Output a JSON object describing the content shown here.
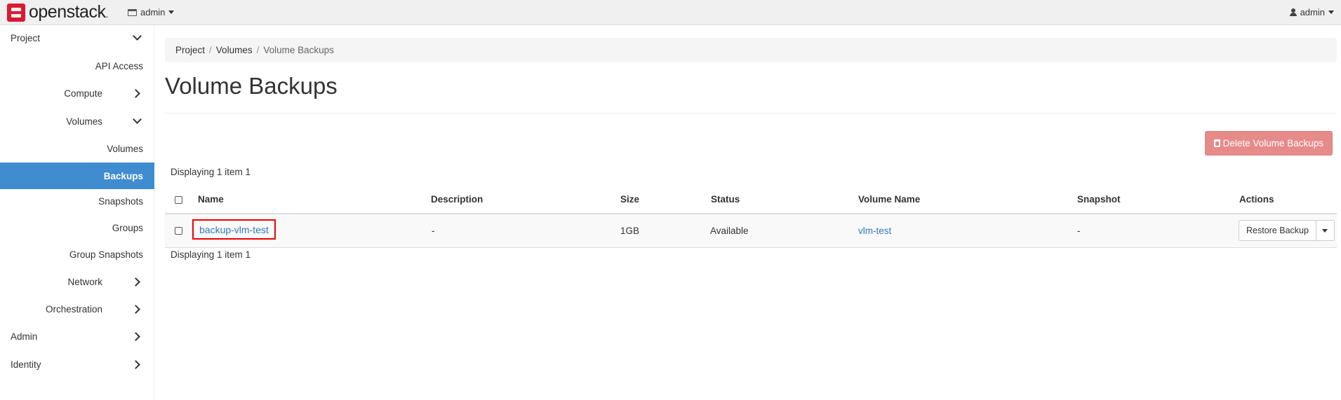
{
  "topbar": {
    "brand": "openstack",
    "brand_dot": ".",
    "project": "admin",
    "user": "admin"
  },
  "sidebar": {
    "items": [
      {
        "label": "Project",
        "level": 1,
        "chevron": "down"
      },
      {
        "label": "API Access",
        "level": 2
      },
      {
        "label": "Compute",
        "level": 2,
        "chevron": "right"
      },
      {
        "label": "Volumes",
        "level": 2,
        "chevron": "down"
      },
      {
        "label": "Volumes",
        "level": 3
      },
      {
        "label": "Backups",
        "level": 3,
        "active": true
      },
      {
        "label": "Snapshots",
        "level": 3
      },
      {
        "label": "Groups",
        "level": 3
      },
      {
        "label": "Group Snapshots",
        "level": 3
      },
      {
        "label": "Network",
        "level": 2,
        "chevron": "right"
      },
      {
        "label": "Orchestration",
        "level": 2,
        "chevron": "right"
      },
      {
        "label": "Admin",
        "level": 1,
        "chevron": "right"
      },
      {
        "label": "Identity",
        "level": 1,
        "chevron": "right"
      }
    ]
  },
  "breadcrumb": [
    "Project",
    "Volumes",
    "Volume Backups"
  ],
  "page": {
    "title": "Volume Backups",
    "delete_button": "Delete Volume Backups",
    "count_text": "Displaying 1 item 1"
  },
  "table": {
    "columns": [
      "Name",
      "Description",
      "Size",
      "Status",
      "Volume Name",
      "Snapshot",
      "Actions"
    ],
    "rows": [
      {
        "name": "backup-vlm-test",
        "description": "-",
        "size": "1GB",
        "status": "Available",
        "volume_name": "vlm-test",
        "snapshot": "-",
        "action": "Restore Backup"
      }
    ]
  },
  "colors": {
    "active_nav": "#3f8cd1",
    "link": "#337ab7",
    "danger_button": "#e68a8a",
    "highlight_box": "#e00000",
    "logo_red": "#da1a32"
  }
}
